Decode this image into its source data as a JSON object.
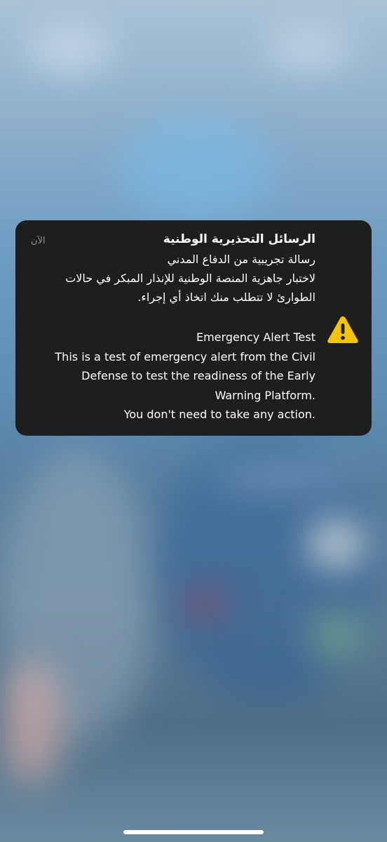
{
  "notification": {
    "title": "الرسائل التحذيرية الوطنية",
    "time": "الآن",
    "arabic_lines": [
      "رسالة تجريبية من الدفاع المدني",
      "لاختبار جاهزية المنصة الوطنية للإنذار المبكر في حالات",
      "الطوارئ لا تتطلب منك اتخاذ أي إجراء."
    ],
    "english_lines": [
      "Emergency Alert Test",
      "This is a test of emergency alert from the Civil",
      "Defense to test the readiness of the Early",
      "Warning Platform.",
      "You don't need to take any action."
    ],
    "icon": "warning-icon",
    "icon_color": "#f5c400"
  },
  "colors": {
    "card_background": "#1e1e1e",
    "secondary_text": "#8e8e93"
  }
}
